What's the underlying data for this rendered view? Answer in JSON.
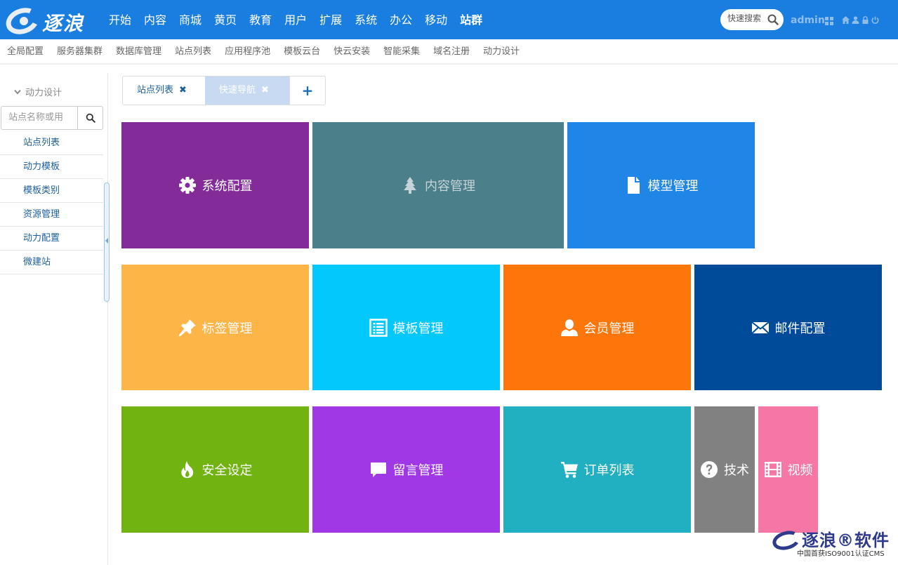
{
  "brand": {
    "logo_text": "逐浪",
    "registered": "®"
  },
  "nav": {
    "items": [
      "开始",
      "内容",
      "商城",
      "黄页",
      "教育",
      "用户",
      "扩展",
      "系统",
      "办公",
      "移动",
      "站群"
    ],
    "active": "站群"
  },
  "search": {
    "placeholder": "快速搜索"
  },
  "user": {
    "name": "admin"
  },
  "subnav": {
    "items": [
      "全局配置",
      "服务器集群",
      "数据库管理",
      "站点列表",
      "应用程序池",
      "模板云台",
      "快云安装",
      "智能采集",
      "域名注册",
      "动力设计"
    ]
  },
  "sidebar": {
    "title": "动力设计",
    "search_placeholder": "站点名称或用",
    "items": [
      "站点列表",
      "动力模板",
      "模板类别",
      "资源管理",
      "动力配置",
      "微建站"
    ]
  },
  "tabs": {
    "items": [
      "站点列表",
      "快速导航"
    ],
    "close_glyph": "✖",
    "add_glyph": "+"
  },
  "tiles": [
    {
      "label": "系统配置",
      "icon": "gear-icon",
      "color": "#822b99"
    },
    {
      "label": "内容管理",
      "icon": "tree-icon",
      "color": "#4b7f8a"
    },
    {
      "label": "模型管理",
      "icon": "file-icon",
      "color": "#1f86e8"
    },
    {
      "label": "标签管理",
      "icon": "pin-icon",
      "color": "#fdb548"
    },
    {
      "label": "模板管理",
      "icon": "list-icon",
      "color": "#02c8fc"
    },
    {
      "label": "会员管理",
      "icon": "user-icon",
      "color": "#fd7609"
    },
    {
      "label": "邮件配置",
      "icon": "envelope-icon",
      "color": "#004a9a"
    },
    {
      "label": "安全设定",
      "icon": "fire-icon",
      "color": "#71b411"
    },
    {
      "label": "留言管理",
      "icon": "comment-icon",
      "color": "#a039e5"
    },
    {
      "label": "订单列表",
      "icon": "cart-icon",
      "color": "#21b0c1"
    },
    {
      "label": "技术",
      "icon": "question-icon",
      "color": "#818181"
    },
    {
      "label": "视频",
      "icon": "film-icon",
      "color": "#f676a6"
    }
  ],
  "watermark": {
    "title": "逐浪®软件",
    "subtitle": "中国首获ISO9001认证CMS"
  }
}
